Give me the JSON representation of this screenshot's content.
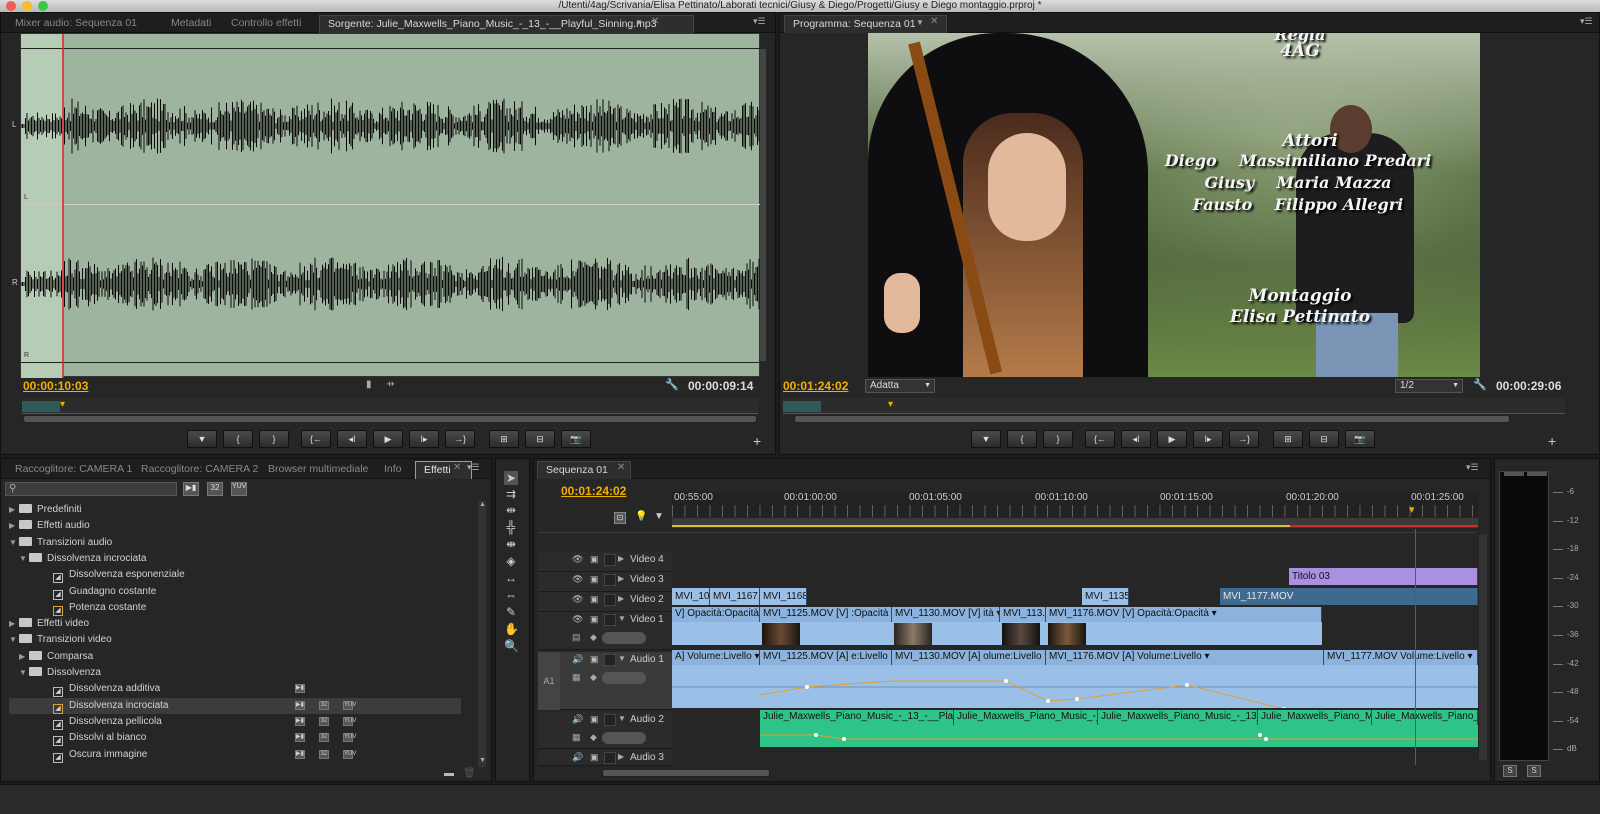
{
  "window": {
    "title": "/Utenti/4ag/Scrivania/Elisa Pettinato/Laborati tecnici/Giusy & Diego/Progetti/Giusy e Diego montaggio.prproj *"
  },
  "source": {
    "tabs": [
      "Mixer audio: Sequenza 01",
      "Metadati",
      "Controllo effetti",
      "Sorgente: Julie_Maxwells_Piano_Music_-_13_-__Playful_Sinning.mp3"
    ],
    "timecode_current": "00:00:10:03",
    "timecode_duration": "00:00:09:14",
    "channel_labels": [
      "L",
      "L",
      "R",
      "R"
    ],
    "buttons": [
      "▼",
      "{",
      "}",
      "{←",
      "◂I",
      "▶",
      "I▸",
      "→}",
      "⊞",
      "⊟",
      "📷"
    ]
  },
  "program": {
    "tab": "Programma: Sequenza 01",
    "timecode_current": "00:01:24:02",
    "zoom": "Adatta",
    "resolution": "1/2",
    "timecode_duration": "00:00:29:06",
    "credits": {
      "top1": "Regia",
      "top2": "4AG",
      "attori": "Attori",
      "line1": "Diego    Massimiliano Predari",
      "line2": "Giusy    Maria Mazza",
      "line3": "Fausto    Filippo Allegri",
      "montaggio": "Montaggio",
      "editor": "Elisa Pettinato"
    },
    "buttons": [
      "▼",
      "{",
      "}",
      "{←",
      "◂I",
      "▶",
      "I▸",
      "→}",
      "⊞",
      "⊟",
      "📷"
    ]
  },
  "project": {
    "tabs": [
      "Raccoglitore: CAMERA 1",
      "Raccoglitore: CAMERA 2",
      "Browser multimediale",
      "Info",
      "Effetti"
    ],
    "search_value": "",
    "filter_badges": [
      "32",
      "YUV"
    ],
    "tree": [
      {
        "label": "Predefiniti",
        "level": 0,
        "open": false,
        "type": "folder"
      },
      {
        "label": "Effetti audio",
        "level": 0,
        "open": false,
        "type": "folder"
      },
      {
        "label": "Transizioni audio",
        "level": 0,
        "open": true,
        "type": "folder"
      },
      {
        "label": "Dissolvenza incrociata",
        "level": 1,
        "open": true,
        "type": "folder"
      },
      {
        "label": "Dissolvenza esponenziale",
        "level": 2,
        "type": "fx"
      },
      {
        "label": "Guadagno costante",
        "level": 2,
        "type": "fx"
      },
      {
        "label": "Potenza costante",
        "level": 2,
        "type": "fx",
        "framed": true
      },
      {
        "label": "Effetti video",
        "level": 0,
        "open": false,
        "type": "folder"
      },
      {
        "label": "Transizioni video",
        "level": 0,
        "open": true,
        "type": "folder"
      },
      {
        "label": "Comparsa",
        "level": 1,
        "open": false,
        "type": "folder"
      },
      {
        "label": "Dissolvenza",
        "level": 1,
        "open": true,
        "type": "folder"
      },
      {
        "label": "Dissolvenza additiva",
        "level": 2,
        "type": "fx",
        "badges": 1
      },
      {
        "label": "Dissolvenza incrociata",
        "level": 2,
        "type": "fx",
        "badges": 3,
        "highlight": true,
        "framed": true
      },
      {
        "label": "Dissolvenza pellicola",
        "level": 2,
        "type": "fx",
        "badges": 3
      },
      {
        "label": "Dissolvi al bianco",
        "level": 2,
        "type": "fx",
        "badges": 3
      },
      {
        "label": "Oscura immagine",
        "level": 2,
        "type": "fx",
        "badges": 3
      }
    ]
  },
  "timeline": {
    "tab": "Sequenza 01",
    "timecode": "00:01:24:02",
    "ruler": [
      "00:55:00",
      "00:01:00:00",
      "00:01:05:00",
      "00:01:10:00",
      "00:01:15:00",
      "00:01:20:00",
      "00:01:25:00"
    ],
    "tracks": {
      "v4": "Video 4",
      "v3": "Video 3",
      "v2": "Video 2",
      "v1": "Video 1",
      "a1": "Audio 1",
      "a2": "Audio 2",
      "a3": "Audio 3",
      "a1_target": "A1"
    },
    "v3_clips": [
      "Titolo 03"
    ],
    "v2_clips": [
      "MVI_10",
      "MVI_1167.",
      "MVI_1168",
      "MVI_1135",
      "MVI_1177.MOV"
    ],
    "v1_clips": [
      "V] Opacità:Opacità ▾",
      "MVI_1125.MOV [V] :Opacità ▾",
      "MVI_1130.MOV [V]  ità ▾",
      "MVI_113.",
      "MVI_1176.MOV [V] Opacità:Opacità ▾"
    ],
    "a1_clips": [
      "A]  Volume:Livello ▾",
      "MVI_1125.MOV [A]  e:Livello ▾",
      "MVI_1130.MOV [A]  olume:Livello ▾",
      "MVI_1176.MOV [A]  Volume:Livello ▾",
      "MVI_1177.MOV  Volume:Livello ▾"
    ],
    "a2_clips": [
      "Julie_Maxwells_Piano_Music_-_13_-__Playfu",
      "Julie_Maxwells_Piano_Music_-_1",
      "Julie_Maxwells_Piano_Music_-_13_-",
      "Julie_Maxwells_Piano_Mu",
      "Julie_Maxwells_Piano_Mu"
    ]
  },
  "meter": {
    "scale": [
      "-6",
      "-12",
      "-18",
      "-24",
      "-30",
      "-36",
      "-42",
      "-48",
      "-54",
      "dB"
    ],
    "solo": [
      "S",
      "S"
    ]
  }
}
